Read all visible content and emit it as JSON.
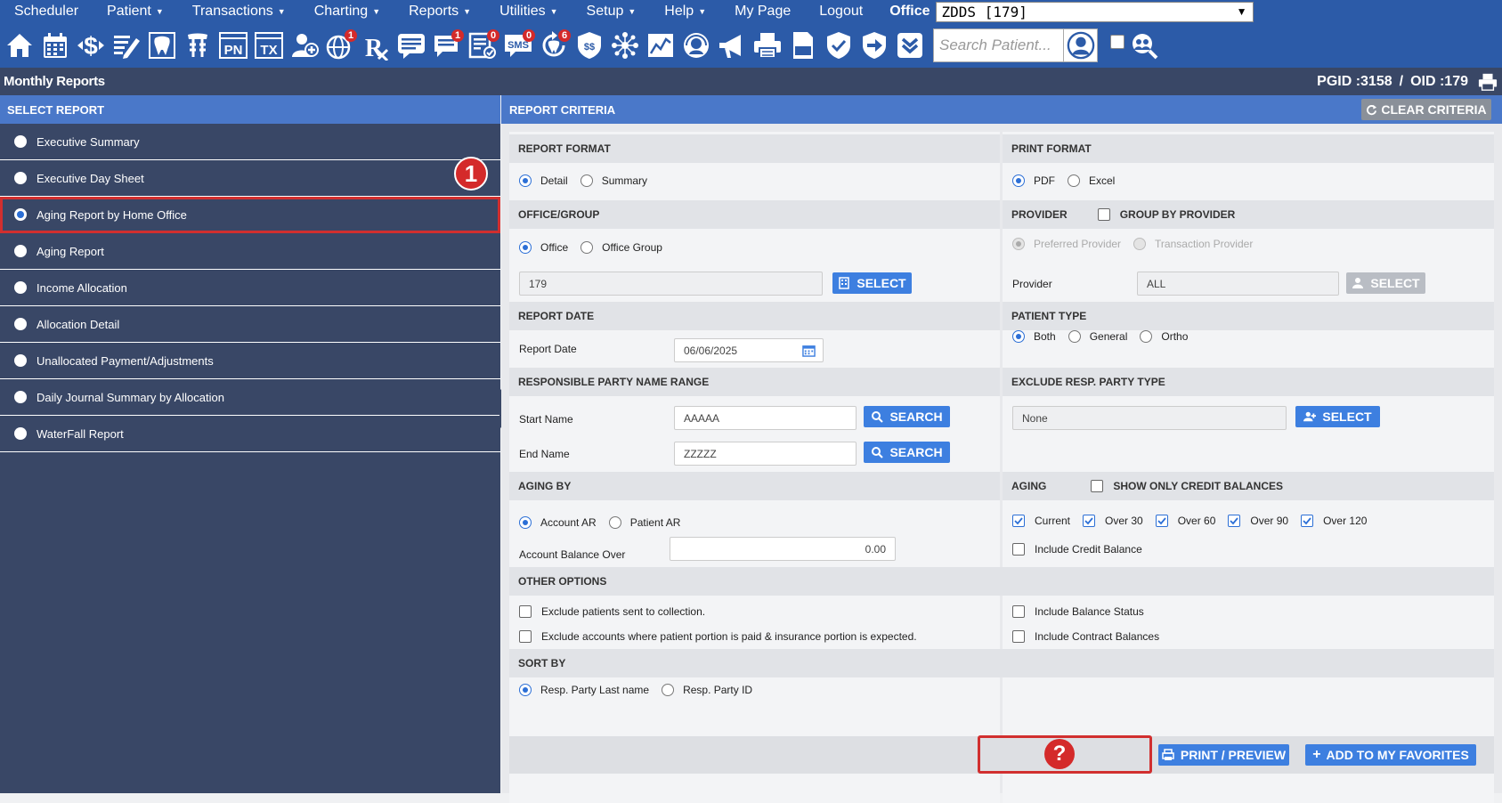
{
  "menu": {
    "items": [
      {
        "label": "Scheduler",
        "caret": false
      },
      {
        "label": "Patient",
        "caret": true
      },
      {
        "label": "Transactions",
        "caret": true
      },
      {
        "label": "Charting",
        "caret": true
      },
      {
        "label": "Reports",
        "caret": true
      },
      {
        "label": "Utilities",
        "caret": true
      },
      {
        "label": "Setup",
        "caret": true
      },
      {
        "label": "Help",
        "caret": true
      },
      {
        "label": "My Page",
        "caret": false
      },
      {
        "label": "Logout",
        "caret": false
      }
    ],
    "office_label": "Office",
    "office_value": "ZDDS [179]"
  },
  "toolbar": {
    "icons": [
      {
        "name": "home-icon"
      },
      {
        "name": "calendar-icon"
      },
      {
        "name": "dollar-icon"
      },
      {
        "name": "notes-edit-icon"
      },
      {
        "name": "tooth-icon"
      },
      {
        "name": "implant-tooth-icon"
      },
      {
        "name": "pn-icon",
        "text": "PN"
      },
      {
        "name": "tx-icon",
        "text": "TX"
      },
      {
        "name": "add-patient-icon"
      },
      {
        "name": "globe-icon",
        "badge": "1"
      },
      {
        "name": "rx-icon",
        "text": "Rx"
      },
      {
        "name": "message-icon"
      },
      {
        "name": "chat-icon",
        "badge": "1"
      },
      {
        "name": "checklist-icon",
        "badge": "0"
      },
      {
        "name": "sms-icon",
        "text": "SMS",
        "badge": "0"
      },
      {
        "name": "recall-icon",
        "badge": "6"
      },
      {
        "name": "payments-icon"
      },
      {
        "name": "network-icon"
      },
      {
        "name": "chart-icon"
      },
      {
        "name": "support-icon"
      },
      {
        "name": "megaphone-icon"
      },
      {
        "name": "printer-icon"
      },
      {
        "name": "document-icon"
      },
      {
        "name": "shield-check-icon"
      },
      {
        "name": "shield-arrow-icon"
      },
      {
        "name": "chevron-down-badge-icon"
      }
    ],
    "search_placeholder": "Search Patient..."
  },
  "titlebar": {
    "title": "Monthly Reports",
    "pgid": "PGID :3158",
    "separator": "/",
    "oid": "OID :179"
  },
  "select_report": {
    "header": "SELECT REPORT",
    "items": [
      {
        "label": "Executive Summary",
        "selected": false
      },
      {
        "label": "Executive Day Sheet",
        "selected": false
      },
      {
        "label": "Aging Report by Home Office",
        "selected": true
      },
      {
        "label": "Aging Report",
        "selected": false
      },
      {
        "label": "Income Allocation",
        "selected": false
      },
      {
        "label": "Allocation Detail",
        "selected": false
      },
      {
        "label": "Unallocated Payment/Adjustments",
        "selected": false
      },
      {
        "label": "Daily Journal Summary by Allocation",
        "selected": false
      },
      {
        "label": "WaterFall Report",
        "selected": false
      }
    ],
    "step_marker": "1"
  },
  "criteria": {
    "header": "REPORT CRITERIA",
    "clear_label": "CLEAR CRITERIA",
    "report_format": {
      "title": "REPORT FORMAT",
      "options": [
        "Detail",
        "Summary"
      ],
      "selected": "Detail"
    },
    "print_format": {
      "title": "PRINT FORMAT",
      "options": [
        "PDF",
        "Excel"
      ],
      "selected": "PDF"
    },
    "office_group": {
      "title": "OFFICE/GROUP",
      "options": [
        "Office",
        "Office Group"
      ],
      "selected": "Office",
      "value": "179",
      "select_label": "SELECT"
    },
    "provider": {
      "title": "PROVIDER",
      "group_by_label": "GROUP BY PROVIDER",
      "options": [
        "Preferred Provider",
        "Transaction Provider"
      ],
      "label": "Provider",
      "value": "ALL",
      "select_label": "SELECT"
    },
    "report_date": {
      "title": "REPORT DATE",
      "label": "Report Date",
      "value": "06/06/2025"
    },
    "patient_type": {
      "title": "PATIENT TYPE",
      "options": [
        "Both",
        "General",
        "Ortho"
      ],
      "selected": "Both"
    },
    "resp_party": {
      "title": "RESPONSIBLE PARTY NAME RANGE",
      "start_label": "Start Name",
      "start_value": "AAAAA",
      "end_label": "End Name",
      "end_value": "ZZZZZ",
      "search_label": "SEARCH"
    },
    "exclude_type": {
      "title": "EXCLUDE RESP. PARTY TYPE",
      "value": "None",
      "select_label": "SELECT"
    },
    "aging_by": {
      "title": "AGING BY",
      "options": [
        "Account AR",
        "Patient AR"
      ],
      "selected": "Account AR",
      "balance_label": "Account Balance Over",
      "balance_value": "0.00"
    },
    "aging": {
      "title": "AGING",
      "credit_only_label": "SHOW ONLY CREDIT BALANCES",
      "buckets": [
        "Current",
        "Over 30",
        "Over 60",
        "Over 90",
        "Over 120"
      ],
      "include_credit_label": "Include Credit Balance"
    },
    "other_options": {
      "title": "OTHER OPTIONS",
      "exclude_collection": "Exclude patients sent to collection.",
      "exclude_paid": "Exclude accounts where patient portion is paid & insurance portion is expected.",
      "include_status": "Include Balance Status",
      "include_contract": "Include Contract Balances"
    },
    "sort_by": {
      "title": "SORT BY",
      "options": [
        "Resp. Party Last name",
        "Resp. Party ID"
      ],
      "selected": "Resp. Party Last name"
    },
    "print_preview_label": "PRINT / PREVIEW",
    "favorites_label": "ADD TO MY FAVORITES",
    "help_marker": "?"
  }
}
